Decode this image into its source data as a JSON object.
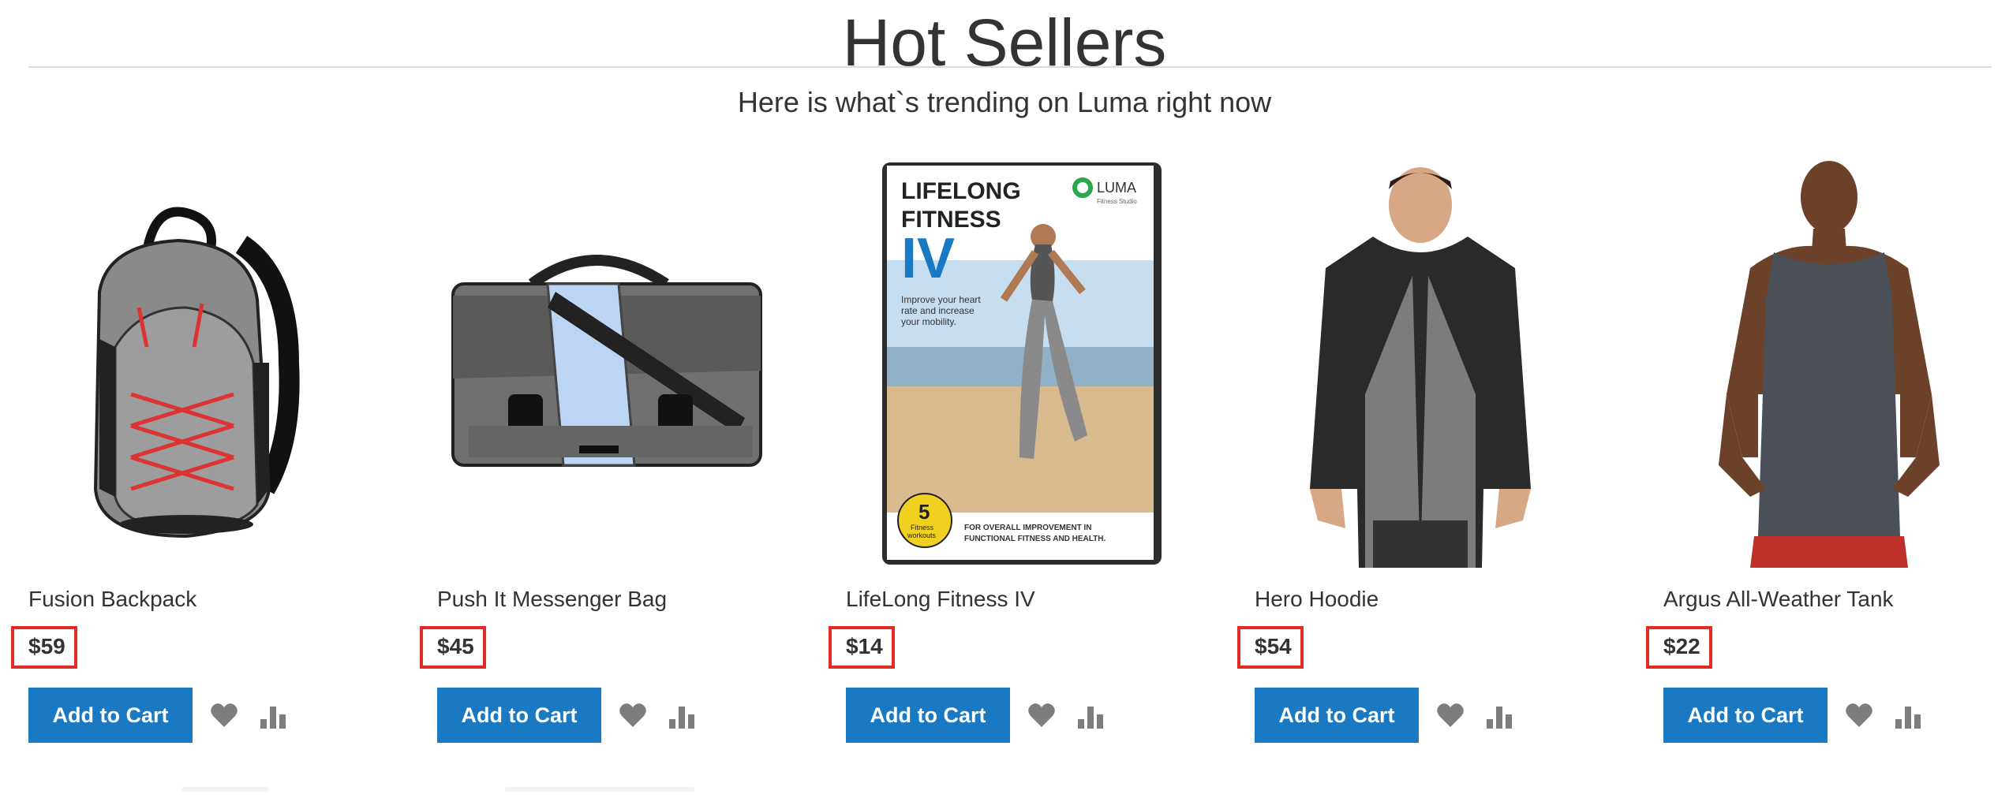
{
  "section": {
    "title": "Hot Sellers",
    "subtitle": "Here is what`s trending on Luma right now"
  },
  "products": [
    {
      "name": "Fusion Backpack",
      "price": "$59",
      "add_to_cart_label": "Add to Cart",
      "image": "backpack-image"
    },
    {
      "name": "Push It Messenger Bag",
      "price": "$45",
      "add_to_cart_label": "Add to Cart",
      "image": "messenger-bag-image"
    },
    {
      "name": "LifeLong Fitness IV",
      "price": "$14",
      "add_to_cart_label": "Add to Cart",
      "image": "fitness-dvd-image"
    },
    {
      "name": "Hero Hoodie",
      "price": "$54",
      "add_to_cart_label": "Add to Cart",
      "image": "hoodie-image"
    },
    {
      "name": "Argus All-Weather Tank",
      "price": "$22",
      "add_to_cart_label": "Add to Cart",
      "image": "tank-top-image"
    }
  ],
  "dvd_cover": {
    "title_line1": "LIFELONG",
    "title_line2": "FITNESS",
    "title_line3": "IV",
    "brand": "LUMA",
    "brand_sub": "Fitness Studio",
    "tagline_1": "Improve your heart",
    "tagline_2": "rate and increase",
    "tagline_3": "your mobility.",
    "badge_number": "5",
    "badge_text_1": "Fitness",
    "badge_text_2": "workouts",
    "footer_1": "FOR OVERALL IMPROVEMENT IN",
    "footer_2": "FUNCTIONAL FITNESS AND HEALTH."
  },
  "icons": {
    "wishlist": "heart-icon",
    "compare": "bar-chart-icon"
  },
  "colors": {
    "button": "#1979c3",
    "price_highlight": "#e02b27",
    "icon": "#7d7d7d"
  }
}
